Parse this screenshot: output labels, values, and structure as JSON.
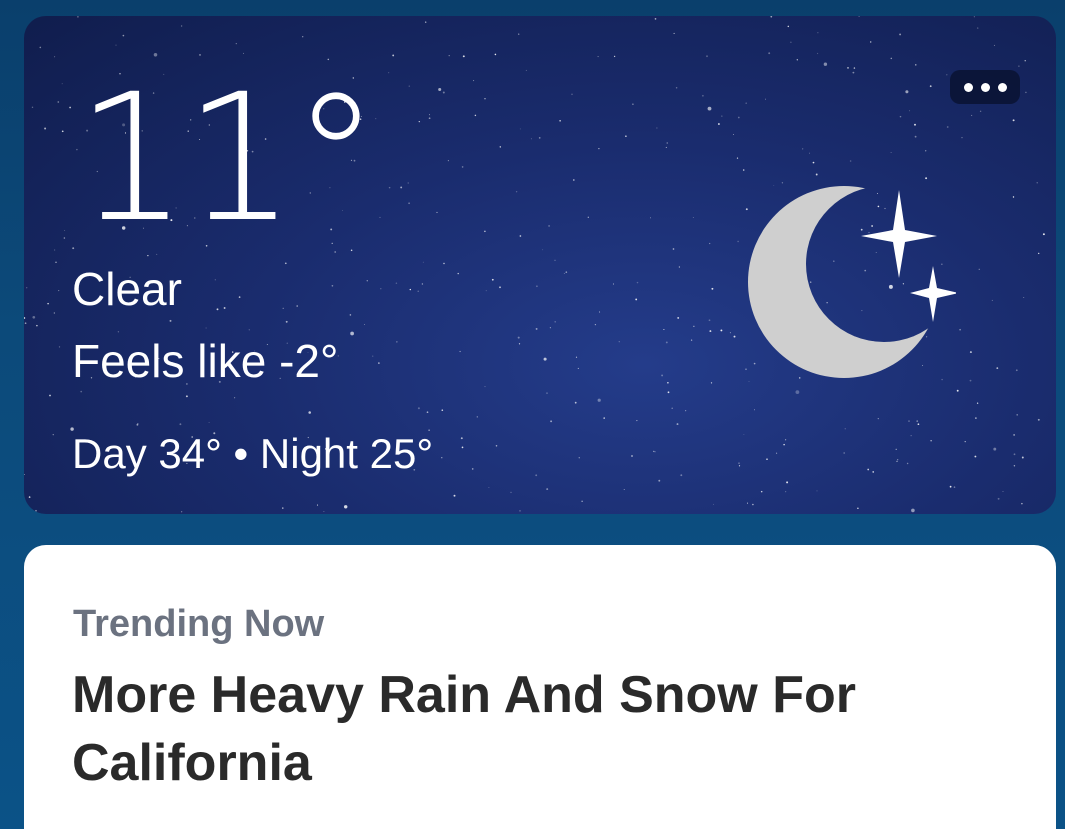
{
  "weather": {
    "temperature": "11°",
    "condition": "Clear",
    "feels_like": "Feels like -2°",
    "day_night": "Day 34° • Night 25°",
    "icon": "moon-stars-icon",
    "more_icon": "more-horizontal-icon"
  },
  "news": {
    "section_label": "Trending Now",
    "headline": "More Heavy Rain And Snow For California"
  },
  "colors": {
    "sky_dark": "#101d4d",
    "sky_light": "#243c8a",
    "moon": "#cfcfcf",
    "page_background": "#0c4a7a",
    "card_background": "#ffffff",
    "label_gray": "#6b7280",
    "headline_text": "#2a2a2a"
  }
}
